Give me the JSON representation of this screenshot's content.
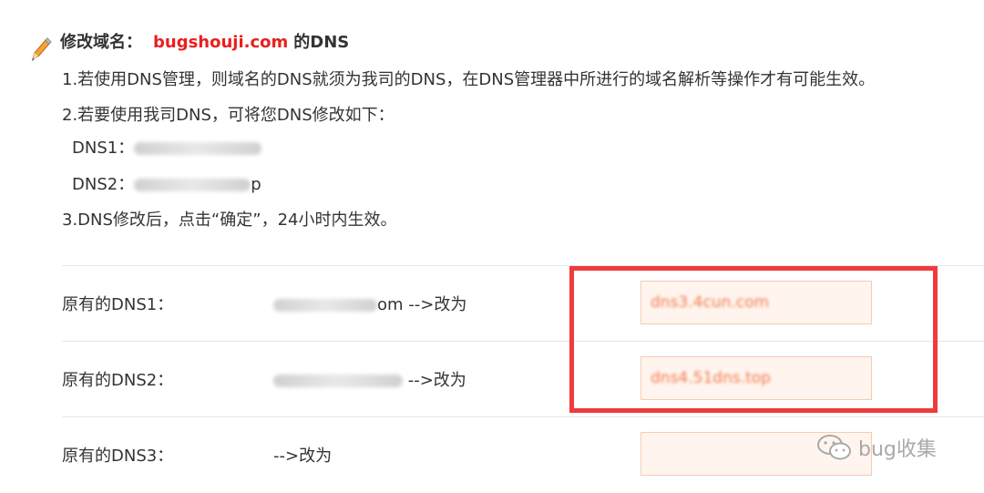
{
  "heading": {
    "prefix": "修改域名：",
    "domain": "bugshouji.com",
    "suffix": "的DNS"
  },
  "instructions": [
    "1.若使用DNS管理，则域名的DNS就须为我司的DNS，在DNS管理器中所进行的域名解析等操作才有可能生效。",
    "2.若要使用我司DNS，可将您DNS修改如下：",
    "3.DNS修改后，点击“确定”，24小时内生效。"
  ],
  "dns_list": [
    {
      "label": "DNS1：",
      "value_visible": ""
    },
    {
      "label": "DNS2：",
      "value_visible": "p"
    }
  ],
  "rows": [
    {
      "label": "原有的DNS1：",
      "old_visible": "om",
      "arrow": "-->改为",
      "new_value": "dns3.4cun.com"
    },
    {
      "label": "原有的DNS2：",
      "old_visible": "",
      "arrow": "-->改为",
      "new_value": "dns4.51dns.top"
    },
    {
      "label": "原有的DNS3：",
      "old_visible": "",
      "arrow": "-->改为",
      "new_value": ""
    }
  ],
  "watermark": {
    "text": "bug收集",
    "icon": "wechat-icon"
  },
  "colors": {
    "accent_red": "#e8201f",
    "highlight_border": "#ef3b3b",
    "input_bg": "#fff5ee",
    "input_text": "#f07a4f"
  }
}
